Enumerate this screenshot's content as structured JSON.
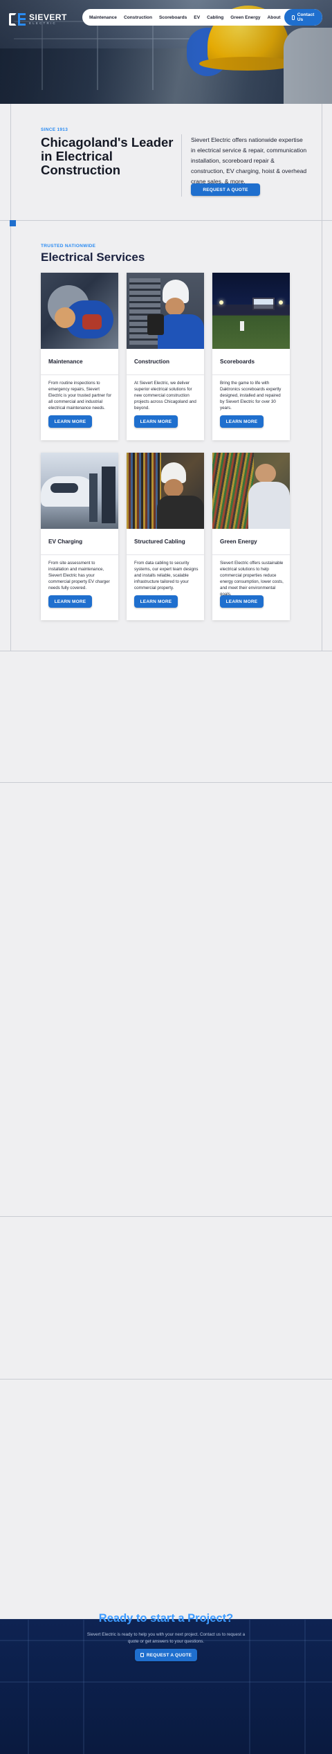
{
  "brand": {
    "name": "SIEVERT",
    "sub": "ELECTRIC"
  },
  "nav": {
    "items": [
      "Maintenance",
      "Construction",
      "Scoreboards",
      "EV",
      "Cabling",
      "Green Energy",
      "About"
    ],
    "cta": "Contact Us"
  },
  "leader": {
    "eyebrow": "SINCE 1913",
    "title": "Chicagoland's Leader in Electrical Construction",
    "text": "Sievert Electric offers nationwide expertise in electrical service & repair, communication installation, scoreboard repair & construction, EV charging, hoist & overhead crane sales, & more.",
    "button": "REQUEST A QUOTE"
  },
  "services": {
    "eyebrow": "TRUSTED NATIONWIDE",
    "title": "Electrical Services",
    "cards": [
      {
        "title": "Maintenance",
        "text": "From routine inspections to emergency repairs, Sievert Electric is your trusted partner for all commercial and industrial electrical maintenance needs.",
        "button": "LEARN MORE"
      },
      {
        "title": "Construction",
        "text": "At Sievert Electric, we deliver superior electrical solutions for new commercial construction projects across Chicagoland and beyond.",
        "button": "LEARN MORE"
      },
      {
        "title": "Scoreboards",
        "text": "Bring the game to life with Daktronics scoreboards expertly designed, installed and repaired by Sievert Electric for over 30 years.",
        "button": "LEARN MORE"
      },
      {
        "title": "EV Charging",
        "text": "From site assessment to installation and maintenance, Sievert Electric has your commercial property EV charger needs fully covered.",
        "button": "LEARN MORE"
      },
      {
        "title": "Structured Cabling",
        "text": "From data cabling to security systems, our expert team designs and installs reliable, scalable infrastructure tailored to your commercial property.",
        "button": "LEARN MORE"
      },
      {
        "title": "Green Energy",
        "text": "Sievert Electric offers sustainable electrical solutions to help commercial properties reduce energy consumption, lower costs, and meet their environmental goals.",
        "button": "LEARN MORE"
      }
    ]
  },
  "cta": {
    "title": "Ready to start a Project?",
    "text": "Sievert Electric is ready to help you with your next project. Contact us to request a quote or get answers to your questions.",
    "button": "REQUEST A QUOTE"
  }
}
